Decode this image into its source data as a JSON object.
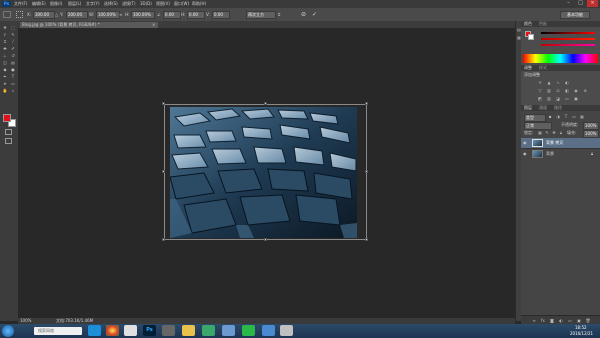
{
  "app": {
    "logo": "Ps"
  },
  "menu": [
    "文件(F)",
    "编辑(E)",
    "图像(I)",
    "图层(L)",
    "文字(Y)",
    "选择(S)",
    "滤镜(T)",
    "3D(D)",
    "视图(V)",
    "窗口(W)",
    "帮助(H)"
  ],
  "options": {
    "x_label": "X:",
    "x_value": "300.00",
    "y_label": "Y:",
    "y_value": "200.00",
    "w_label": "W:",
    "w_value": "100.00%",
    "h_label": "H:",
    "h_value": "100.00%",
    "angle_value": "0.00",
    "h_skew": "0.00",
    "v_skew": "0.00",
    "interp": "两次立方"
  },
  "workspace": "基本功能",
  "doc_tab": "Bing.jpg @ 100% (背景 拷贝, RGB/8#) *",
  "status": {
    "zoom": "100%",
    "doc": "文档:703.1K/1.46M"
  },
  "panels": {
    "color_tab": "颜色",
    "swatches_tab": "色板",
    "adjust_tab": "调整",
    "styles_tab": "样式",
    "adjust_label": "添加调整",
    "layers_tab": "图层",
    "channels_tab": "通道",
    "paths_tab": "路径",
    "kind_label": "类型",
    "blend_mode": "正常",
    "opacity_label": "不透明度:",
    "opacity_value": "100%",
    "lock_label": "锁定:",
    "fill_label": "填充:",
    "fill_value": "100%",
    "layers": [
      "背景 拷贝",
      "背景"
    ]
  },
  "taskbar": {
    "search_placeholder": "搜索网络",
    "time": "18:52",
    "date": "2016/12/21"
  },
  "colors": {
    "fg": "#e3101a",
    "bg": "#ffffff",
    "accent": "#3fa0ff"
  }
}
